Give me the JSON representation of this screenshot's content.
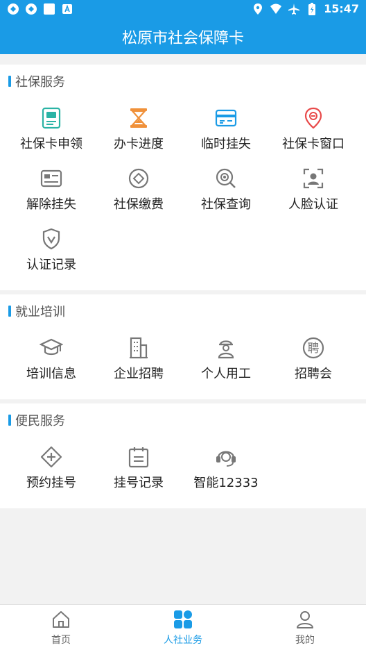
{
  "status": {
    "time": "15:47"
  },
  "header": {
    "title": "松原市社会保障卡"
  },
  "sections": [
    {
      "title": "社保服务",
      "items": [
        {
          "label": "社保卡申领",
          "icon": "id-card-icon"
        },
        {
          "label": "办卡进度",
          "icon": "hourglass-icon"
        },
        {
          "label": "临时挂失",
          "icon": "card-lost-icon"
        },
        {
          "label": "社保卡窗口",
          "icon": "location-pin-icon"
        },
        {
          "label": "解除挂失",
          "icon": "card-unlock-icon"
        },
        {
          "label": "社保缴费",
          "icon": "payment-icon"
        },
        {
          "label": "社保查询",
          "icon": "search-icon"
        },
        {
          "label": "人脸认证",
          "icon": "face-scan-icon"
        },
        {
          "label": "认证记录",
          "icon": "shield-check-icon"
        }
      ]
    },
    {
      "title": "就业培训",
      "items": [
        {
          "label": "培训信息",
          "icon": "graduation-cap-icon"
        },
        {
          "label": "企业招聘",
          "icon": "building-icon"
        },
        {
          "label": "个人用工",
          "icon": "worker-icon"
        },
        {
          "label": "招聘会",
          "icon": "hire-icon"
        }
      ]
    },
    {
      "title": "便民服务",
      "items": [
        {
          "label": "预约挂号",
          "icon": "medical-plus-icon"
        },
        {
          "label": "挂号记录",
          "icon": "calendar-icon"
        },
        {
          "label": "智能12333",
          "icon": "headset-icon"
        }
      ]
    }
  ],
  "hire_icon_glyph": "聘",
  "tabs": [
    {
      "label": "首页",
      "icon": "home-icon",
      "active": false
    },
    {
      "label": "人社业务",
      "icon": "grid-icon",
      "active": true
    },
    {
      "label": "我的",
      "icon": "user-icon",
      "active": false
    }
  ],
  "colors": {
    "primary": "#1a9be6",
    "teal": "#2ab3a5",
    "orange": "#f0913a",
    "red": "#e84a4a",
    "gray": "#777777"
  }
}
